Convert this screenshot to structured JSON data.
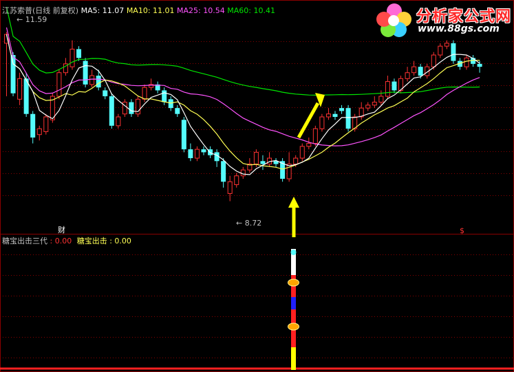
{
  "header": {
    "stock": "江苏索普(日线 前复权)",
    "ma5": "MA5: 11.07",
    "ma10": "MA10: 11.01",
    "ma25": "MA25: 10.54",
    "ma60": "MA60: 10.41"
  },
  "indicator": {
    "name": "糖宝出击三代",
    "value1": ": 0.00",
    "label2": "糖宝出击",
    "value2": ": 0.00"
  },
  "annotations": {
    "high_label": "11.59",
    "low_label": "8.72",
    "cai_label": "财",
    "dollar_label": "$"
  },
  "logo": {
    "text": "分析家公式网",
    "url": "www.88gs.com"
  },
  "colors": {
    "up": "#ff3232",
    "down": "#54fcfc",
    "ma5": "#ffffff",
    "ma10": "#ffff54",
    "ma25": "#ff54ff",
    "ma60": "#00e600",
    "grid": "#8b0000",
    "arrow": "#ffff00"
  },
  "chart_data": {
    "type": "candlestick",
    "high": 11.59,
    "low": 8.72,
    "candles": [
      [
        11.4,
        11.55,
        10.5,
        11.59
      ],
      [
        11.2,
        10.55,
        10.5,
        11.25
      ],
      [
        10.45,
        10.8,
        10.35,
        10.9
      ],
      [
        10.8,
        10.2,
        10.15,
        10.9
      ],
      [
        10.2,
        9.8,
        9.7,
        10.25
      ],
      [
        9.85,
        9.95,
        9.75,
        10.0
      ],
      [
        9.9,
        10.15,
        9.85,
        10.2
      ],
      [
        10.1,
        10.5,
        10.05,
        10.55
      ],
      [
        10.5,
        10.9,
        10.45,
        10.95
      ],
      [
        10.9,
        11.05,
        10.85,
        11.15
      ],
      [
        11.0,
        11.3,
        10.95,
        11.45
      ],
      [
        11.3,
        11.15,
        11.1,
        11.35
      ],
      [
        11.1,
        10.7,
        10.65,
        11.15
      ],
      [
        10.7,
        10.85,
        10.65,
        10.95
      ],
      [
        10.85,
        10.65,
        10.6,
        10.95
      ],
      [
        10.6,
        10.5,
        10.45,
        10.65
      ],
      [
        10.5,
        10.0,
        9.95,
        10.55
      ],
      [
        10.0,
        10.15,
        9.95,
        10.2
      ],
      [
        10.2,
        10.4,
        10.15,
        10.45
      ],
      [
        10.4,
        10.2,
        10.15,
        10.45
      ],
      [
        10.2,
        10.45,
        10.15,
        10.5
      ],
      [
        10.45,
        10.65,
        10.4,
        10.7
      ],
      [
        10.65,
        10.7,
        10.6,
        10.8
      ],
      [
        10.7,
        10.6,
        10.55,
        10.75
      ],
      [
        10.6,
        10.4,
        10.35,
        10.65
      ],
      [
        10.45,
        10.3,
        10.25,
        10.5
      ],
      [
        10.3,
        10.2,
        10.15,
        10.35
      ],
      [
        10.1,
        9.6,
        9.55,
        10.15
      ],
      [
        9.6,
        9.45,
        9.4,
        9.7
      ],
      [
        9.45,
        9.6,
        9.4,
        9.65
      ],
      [
        9.6,
        9.55,
        9.5,
        9.65
      ],
      [
        9.6,
        9.5,
        9.45,
        9.65
      ],
      [
        9.55,
        9.4,
        9.3,
        9.6
      ],
      [
        9.4,
        9.05,
        8.95,
        9.45
      ],
      [
        8.85,
        9.05,
        8.72,
        9.15
      ],
      [
        9.0,
        9.15,
        8.95,
        9.2
      ],
      [
        9.15,
        9.25,
        9.1,
        9.3
      ],
      [
        9.25,
        9.35,
        9.2,
        9.45
      ],
      [
        9.35,
        9.55,
        9.3,
        9.6
      ],
      [
        9.4,
        9.35,
        9.25,
        9.5
      ],
      [
        9.35,
        9.45,
        9.3,
        9.55
      ],
      [
        9.4,
        9.35,
        9.3,
        9.45
      ],
      [
        9.4,
        9.1,
        9.05,
        9.45
      ],
      [
        9.1,
        9.35,
        9.05,
        9.55
      ],
      [
        9.35,
        9.45,
        9.3,
        9.5
      ],
      [
        9.45,
        9.65,
        9.4,
        9.7
      ],
      [
        9.65,
        9.7,
        9.6,
        9.8
      ],
      [
        9.7,
        9.95,
        9.65,
        10.0
      ],
      [
        9.95,
        10.15,
        9.9,
        10.2
      ],
      [
        10.15,
        10.2,
        10.1,
        10.3
      ],
      [
        10.2,
        10.15,
        10.1,
        10.25
      ],
      [
        10.3,
        10.25,
        10.2,
        10.35
      ],
      [
        10.3,
        9.95,
        9.9,
        10.35
      ],
      [
        9.95,
        10.15,
        9.9,
        10.2
      ],
      [
        10.15,
        10.3,
        10.1,
        10.4
      ],
      [
        10.3,
        10.35,
        10.25,
        10.4
      ],
      [
        10.35,
        10.4,
        10.3,
        10.5
      ],
      [
        10.4,
        10.5,
        10.35,
        10.6
      ],
      [
        10.5,
        10.75,
        10.45,
        10.85
      ],
      [
        10.75,
        10.6,
        10.55,
        10.8
      ],
      [
        10.6,
        10.8,
        10.55,
        10.85
      ],
      [
        10.8,
        10.9,
        10.75,
        11.0
      ],
      [
        10.9,
        11.0,
        10.85,
        11.1
      ],
      [
        11.0,
        10.85,
        10.8,
        11.05
      ],
      [
        10.85,
        11.0,
        10.8,
        11.05
      ],
      [
        11.0,
        11.2,
        10.95,
        11.25
      ],
      [
        11.2,
        11.35,
        11.15,
        11.4
      ],
      [
        11.35,
        11.4,
        11.3,
        11.45
      ],
      [
        11.4,
        11.1,
        11.05,
        11.45
      ],
      [
        11.1,
        11.0,
        10.95,
        11.15
      ],
      [
        11.0,
        11.15,
        10.95,
        11.2
      ],
      [
        11.15,
        11.05,
        11.0,
        11.2
      ],
      [
        11.05,
        11.0,
        10.9,
        11.1
      ]
    ]
  }
}
